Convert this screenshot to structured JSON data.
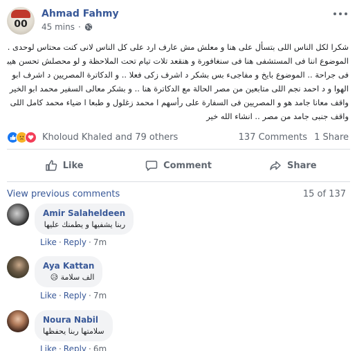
{
  "post": {
    "author": "Ahmad Fahmy",
    "avatar_number": "00",
    "time": "45 mins",
    "privacy_icon": "globe-icon",
    "body_lines": [
      "شكرا لكل الناس اللى بتسأل على هنا و معلش مش عارف ارد على كل الناس لانى كنت محتاس لوحدى ..",
      "الموضوع اننا فى المستشفى هنا فى سنغافورة و هنقعد تلات تيام تحت الملاحظة و لو محصلش تحسن هيبقى",
      "فى جراحة .. الموضوع بايخ و مفاجىء بس بشكر د اشرف زكى فعلا .. و الدكاترة المصريين د اشرف ابو",
      "الهوا و د احمد نجم اللى متابعين من مصر الحالة مع الدكاترة هنا .. و بشكر معالى السفير محمد ابو الخير اللى",
      "واقف معانا جامد هو و المصريين فى السفارة على رأسهم ا محمد زغلول و طبعا ا ضياء محمد كامل اللى",
      "واقف جنبى جامد من مصر .. انشاء الله خير"
    ]
  },
  "reactions": {
    "summary": "Kholoud Khaled and 79 others",
    "comments": "137 Comments",
    "shares": "1 Share",
    "icons": [
      "like-icon",
      "sad-icon",
      "love-icon"
    ]
  },
  "actions": {
    "like": "Like",
    "comment": "Comment",
    "share": "Share"
  },
  "comments_header": {
    "view_previous": "View previous comments",
    "count": "15 of 137"
  },
  "comments": [
    {
      "name": "Amir Salaheldeen",
      "text": "ربنا يشفيها و يطمنك عليها",
      "like": "Like",
      "reply": "Reply",
      "time": "7m"
    },
    {
      "name": "Aya Kattan",
      "text": "الف سلامة",
      "emoji": "😥",
      "like": "Like",
      "reply": "Reply",
      "time": "7m"
    },
    {
      "name": "Noura Nabil",
      "text": "سلامتها ربنا يحفظها",
      "like": "Like",
      "reply": "Reply",
      "time": "6m"
    }
  ],
  "colors": {
    "link": "#385898",
    "secondary": "#606770",
    "bubble": "#f2f3f5",
    "like": "#1877f2",
    "love": "#f33e58",
    "sad": "#f7b125"
  }
}
